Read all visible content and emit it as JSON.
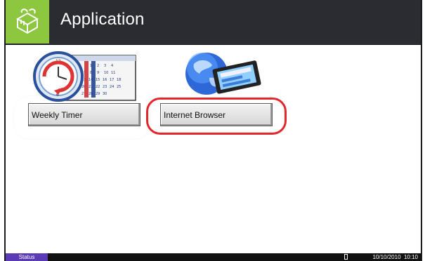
{
  "header": {
    "title": "Application",
    "icon": "application-box-icon"
  },
  "apps": [
    {
      "label": "Weekly Timer",
      "icon": "weekly-timer-icon",
      "highlight": "white"
    },
    {
      "label": "Internet Browser",
      "icon": "internet-browser-icon",
      "highlight": "red"
    }
  ],
  "status_bar": {
    "status_label": "Status",
    "datetime": "10/10/2010  10:10"
  },
  "colors": {
    "header_bg": "#2b2c31",
    "app_icon_bg": "#8dc63f",
    "status_bg": "#5b3bb5",
    "highlight_red": "#e3262b"
  }
}
